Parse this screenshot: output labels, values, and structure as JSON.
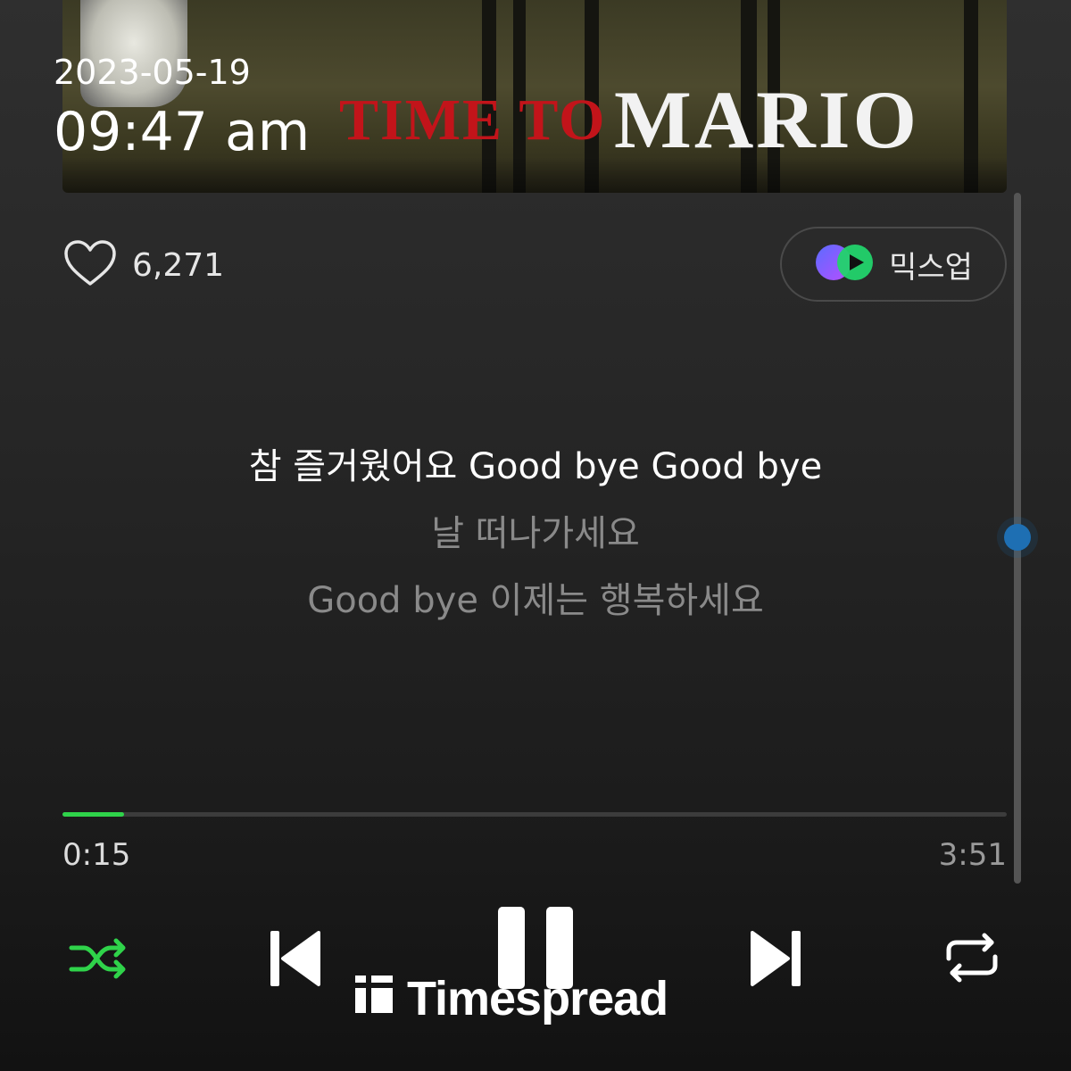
{
  "status": {
    "date": "2023-05-19",
    "time": "09:47 am"
  },
  "album_art": {
    "title_red": "TIME TO",
    "title_white": "MARIO"
  },
  "like": {
    "icon": "heart-outline-icon",
    "count": "6,271"
  },
  "mixup": {
    "label": "믹스업",
    "icon": "mixup-logo-icon"
  },
  "lyrics": {
    "current": "참 즐거웠어요 Good bye Good bye",
    "next1": "날 떠나가세요",
    "next2": "Good bye 이제는 행복하세요"
  },
  "playback": {
    "current_time": "0:15",
    "total_time": "3:51",
    "progress": 0.065
  },
  "controls": {
    "shuffle_icon": "shuffle-icon",
    "prev_icon": "previous-track-icon",
    "pause_icon": "pause-icon",
    "next_icon": "next-track-icon",
    "repeat_icon": "repeat-icon"
  },
  "watermark": {
    "text": "Timespread"
  },
  "colors": {
    "accent_green": "#2fd34a",
    "scroll_blue": "#1e6fb3",
    "album_red": "#c2141a"
  }
}
